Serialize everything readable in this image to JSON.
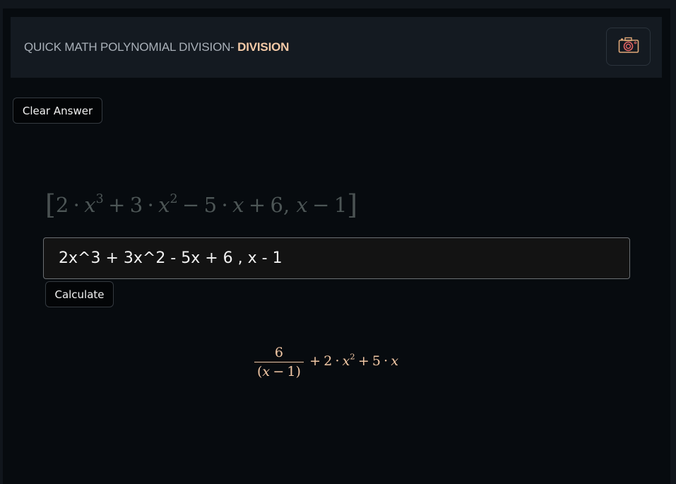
{
  "header": {
    "title_prefix": "QUICK MATH POLYNOMIAL DIVISION- ",
    "title_accent": "DIVISION",
    "camera_icon": "camera-icon"
  },
  "buttons": {
    "clear_label": "Clear Answer",
    "calculate_label": "Calculate"
  },
  "parsed_input": {
    "latex": "[2·x^3 + 3·x^2 − 5·x + 6, x − 1]",
    "terms": {
      "open": "[",
      "c1": "2",
      "dot": "·",
      "x": "x",
      "p3": "3",
      "plus": "+",
      "c2": "3",
      "p2": "2",
      "minus": "−",
      "c3": "5",
      "c4": "6",
      "comma": ",",
      "c5": "1",
      "close": "]"
    }
  },
  "input": {
    "value": "2x^3 + 3x^2 - 5x + 6 , x - 1"
  },
  "result": {
    "text": "6/(x − 1) + 2·x^2 + 5·x",
    "numerator": "6",
    "denominator_open": "(",
    "denominator_var": "x",
    "denominator_op": "−",
    "denominator_const": "1",
    "denominator_close": ")",
    "plus": "+",
    "coef1": "2",
    "dot": "·",
    "var": "x",
    "power": "2",
    "coef2": "5"
  },
  "colors": {
    "accent": "#f3c9a6",
    "background": "#070b0f",
    "header_bg": "#141a21"
  }
}
